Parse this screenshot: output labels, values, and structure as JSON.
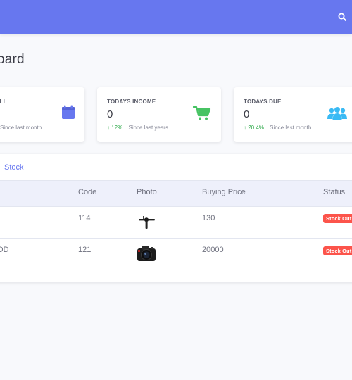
{
  "header": {
    "bg_color": "#6777ef",
    "search_icon": "search-icon"
  },
  "page": {
    "title": "oard"
  },
  "cards": [
    {
      "label": "ELL",
      "value": "",
      "trend": "",
      "since": "Since last month",
      "icon": "calendar-icon",
      "icon_color": "#6777ef"
    },
    {
      "label": "TODAYS INCOME",
      "value": "0",
      "trend": "12%",
      "since": "Since last years",
      "icon": "cart-icon",
      "icon_color": "#47c363"
    },
    {
      "label": "TODAYS DUE",
      "value": "0",
      "trend": "20.4%",
      "since": "Since last month",
      "icon": "users-icon",
      "icon_color": "#3abaf4"
    }
  ],
  "stock": {
    "title": "Stock",
    "columns": [
      "Code",
      "Photo",
      "Buying Price",
      "Status"
    ],
    "rows": [
      {
        "name": "",
        "code": "114",
        "photo": "gimbal-photo",
        "price": "130",
        "status": "Stock Out"
      },
      {
        "name": "OD",
        "code": "121",
        "photo": "camera-photo",
        "price": "20000",
        "status": "Stock Out"
      }
    ]
  },
  "colors": {
    "accent": "#6777ef",
    "success": "#28a745",
    "danger": "#fc544b"
  }
}
